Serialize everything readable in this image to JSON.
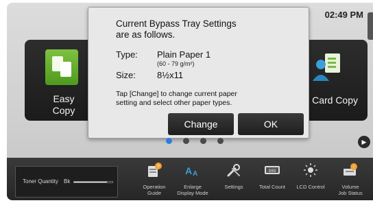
{
  "status": {
    "clock": "02:49 PM"
  },
  "home": {
    "tiles": [
      {
        "label_line1": "Easy",
        "label_line2": "Copy"
      },
      {
        "label": "Card Copy"
      }
    ],
    "page_indicator": {
      "count": 4,
      "active_index": 0
    }
  },
  "dialog": {
    "title_line1": "Current Bypass Tray Settings",
    "title_line2": "are as follows.",
    "type_label": "Type:",
    "type_value": "Plain Paper 1",
    "type_sub": "(60 - 79 g/m²)",
    "size_label": "Size:",
    "size_value": "8½x11",
    "message_line1": "Tap [Change] to change current paper",
    "message_line2": "setting and select other paper types.",
    "change_label": "Change",
    "ok_label": "OK"
  },
  "bottom_bar": {
    "toner_label": "Toner Quantity",
    "toner_color": "Bk",
    "toner_level": 0.85,
    "items": [
      {
        "line1": "Operation",
        "line2": "Guide"
      },
      {
        "line1": "Enlarge",
        "line2": "Display Mode"
      },
      {
        "line1": "Settings",
        "line2": ""
      },
      {
        "line1": "Total Count",
        "line2": ""
      },
      {
        "line1": "LCD Control",
        "line2": ""
      },
      {
        "line1": "Volume",
        "line2": "Job Status"
      }
    ]
  },
  "colors": {
    "accent": "#2e7ce3",
    "copy_green": "#6cb63a",
    "warning_orange": "#f0a030"
  }
}
